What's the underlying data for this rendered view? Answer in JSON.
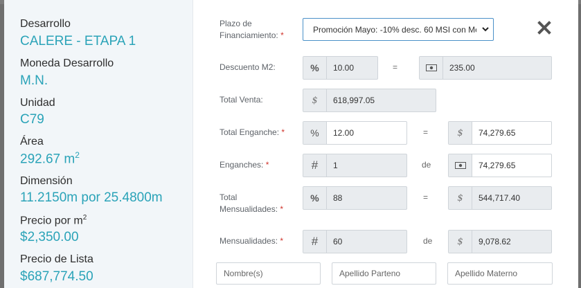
{
  "left_panel": {
    "desarrollo": {
      "label": "Desarrollo",
      "value": "CALERE - ETAPA 1"
    },
    "moneda": {
      "label": "Moneda Desarrollo",
      "value": "M.N."
    },
    "unidad": {
      "label": "Unidad",
      "value": "C79"
    },
    "area": {
      "label": "Área",
      "value": "292.67 m",
      "unit_sup": "2"
    },
    "dimension": {
      "label": "Dimensión",
      "value": "11.2150m por 25.4800m"
    },
    "precio_m2": {
      "label": "Precio por m",
      "label_sup": "2",
      "value": "$2,350.00"
    },
    "precio_lista": {
      "label": "Precio de Lista",
      "value": "$687,774.50"
    }
  },
  "form": {
    "plazo": {
      "label_line1": "Plazo de",
      "label_line2": "Financiamiento:",
      "required": "*",
      "selected": "Promoción Mayo: -10% desc. 60 MSI con Men"
    },
    "descuento": {
      "label": "Descuento M2:",
      "percent_addon": "%",
      "percent_value": "10.00",
      "equals": "=",
      "money_addon_icon": "cash-icon",
      "money_value": "235.00"
    },
    "total_venta": {
      "label": "Total Venta:",
      "addon": "$",
      "value": "618,997.05"
    },
    "total_enganche": {
      "label": "Total Enganche:",
      "required": "*",
      "percent_addon": "%",
      "percent_value": "12.00",
      "equals": "=",
      "money_addon": "$",
      "money_value": "74,279.65"
    },
    "enganches": {
      "label": "Enganches:",
      "required": "*",
      "count_addon": "#",
      "count_value": "1",
      "de": "de",
      "money_addon_icon": "cash-icon",
      "money_value": "74,279.65"
    },
    "total_mensualidades": {
      "label_line1": "Total",
      "label_line2": "Mensualidades:",
      "required": "*",
      "percent_addon": "%",
      "percent_value": "88",
      "equals": "=",
      "money_addon": "$",
      "money_value": "544,717.40"
    },
    "mensualidades": {
      "label": "Mensualidades:",
      "required": "*",
      "count_addon": "#",
      "count_value": "60",
      "de": "de",
      "money_addon": "$",
      "money_value": "9,078.62"
    },
    "nombre_placeholder": "Nombre(s)",
    "apellido_paterno_placeholder": "Apellido Parteno",
    "apellido_materno_placeholder": "Apellido Materno"
  },
  "close_icon": "close-icon",
  "colors": {
    "accent": "#2aa3b8",
    "required": "#d0342c",
    "select_border": "#4a90c8"
  }
}
